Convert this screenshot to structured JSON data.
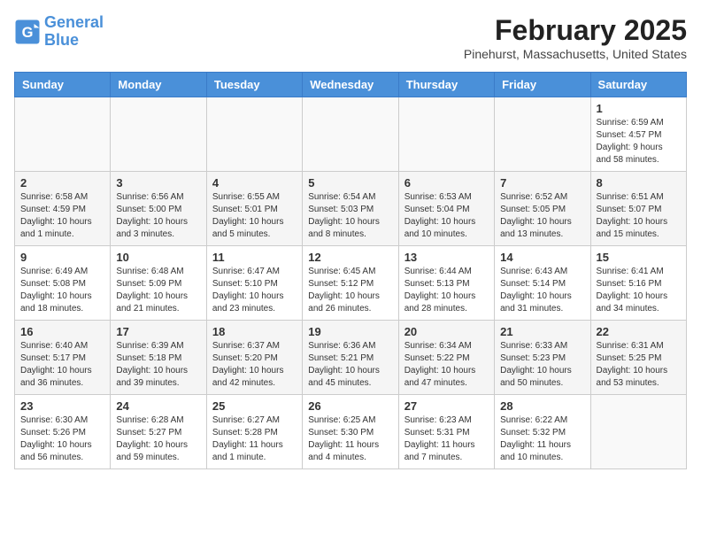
{
  "header": {
    "logo_line1": "General",
    "logo_line2": "Blue",
    "title": "February 2025",
    "subtitle": "Pinehurst, Massachusetts, United States"
  },
  "days_of_week": [
    "Sunday",
    "Monday",
    "Tuesday",
    "Wednesday",
    "Thursday",
    "Friday",
    "Saturday"
  ],
  "weeks": [
    [
      {
        "day": "",
        "info": ""
      },
      {
        "day": "",
        "info": ""
      },
      {
        "day": "",
        "info": ""
      },
      {
        "day": "",
        "info": ""
      },
      {
        "day": "",
        "info": ""
      },
      {
        "day": "",
        "info": ""
      },
      {
        "day": "1",
        "info": "Sunrise: 6:59 AM\nSunset: 4:57 PM\nDaylight: 9 hours\nand 58 minutes."
      }
    ],
    [
      {
        "day": "2",
        "info": "Sunrise: 6:58 AM\nSunset: 4:59 PM\nDaylight: 10 hours\nand 1 minute."
      },
      {
        "day": "3",
        "info": "Sunrise: 6:56 AM\nSunset: 5:00 PM\nDaylight: 10 hours\nand 3 minutes."
      },
      {
        "day": "4",
        "info": "Sunrise: 6:55 AM\nSunset: 5:01 PM\nDaylight: 10 hours\nand 5 minutes."
      },
      {
        "day": "5",
        "info": "Sunrise: 6:54 AM\nSunset: 5:03 PM\nDaylight: 10 hours\nand 8 minutes."
      },
      {
        "day": "6",
        "info": "Sunrise: 6:53 AM\nSunset: 5:04 PM\nDaylight: 10 hours\nand 10 minutes."
      },
      {
        "day": "7",
        "info": "Sunrise: 6:52 AM\nSunset: 5:05 PM\nDaylight: 10 hours\nand 13 minutes."
      },
      {
        "day": "8",
        "info": "Sunrise: 6:51 AM\nSunset: 5:07 PM\nDaylight: 10 hours\nand 15 minutes."
      }
    ],
    [
      {
        "day": "9",
        "info": "Sunrise: 6:49 AM\nSunset: 5:08 PM\nDaylight: 10 hours\nand 18 minutes."
      },
      {
        "day": "10",
        "info": "Sunrise: 6:48 AM\nSunset: 5:09 PM\nDaylight: 10 hours\nand 21 minutes."
      },
      {
        "day": "11",
        "info": "Sunrise: 6:47 AM\nSunset: 5:10 PM\nDaylight: 10 hours\nand 23 minutes."
      },
      {
        "day": "12",
        "info": "Sunrise: 6:45 AM\nSunset: 5:12 PM\nDaylight: 10 hours\nand 26 minutes."
      },
      {
        "day": "13",
        "info": "Sunrise: 6:44 AM\nSunset: 5:13 PM\nDaylight: 10 hours\nand 28 minutes."
      },
      {
        "day": "14",
        "info": "Sunrise: 6:43 AM\nSunset: 5:14 PM\nDaylight: 10 hours\nand 31 minutes."
      },
      {
        "day": "15",
        "info": "Sunrise: 6:41 AM\nSunset: 5:16 PM\nDaylight: 10 hours\nand 34 minutes."
      }
    ],
    [
      {
        "day": "16",
        "info": "Sunrise: 6:40 AM\nSunset: 5:17 PM\nDaylight: 10 hours\nand 36 minutes."
      },
      {
        "day": "17",
        "info": "Sunrise: 6:39 AM\nSunset: 5:18 PM\nDaylight: 10 hours\nand 39 minutes."
      },
      {
        "day": "18",
        "info": "Sunrise: 6:37 AM\nSunset: 5:20 PM\nDaylight: 10 hours\nand 42 minutes."
      },
      {
        "day": "19",
        "info": "Sunrise: 6:36 AM\nSunset: 5:21 PM\nDaylight: 10 hours\nand 45 minutes."
      },
      {
        "day": "20",
        "info": "Sunrise: 6:34 AM\nSunset: 5:22 PM\nDaylight: 10 hours\nand 47 minutes."
      },
      {
        "day": "21",
        "info": "Sunrise: 6:33 AM\nSunset: 5:23 PM\nDaylight: 10 hours\nand 50 minutes."
      },
      {
        "day": "22",
        "info": "Sunrise: 6:31 AM\nSunset: 5:25 PM\nDaylight: 10 hours\nand 53 minutes."
      }
    ],
    [
      {
        "day": "23",
        "info": "Sunrise: 6:30 AM\nSunset: 5:26 PM\nDaylight: 10 hours\nand 56 minutes."
      },
      {
        "day": "24",
        "info": "Sunrise: 6:28 AM\nSunset: 5:27 PM\nDaylight: 10 hours\nand 59 minutes."
      },
      {
        "day": "25",
        "info": "Sunrise: 6:27 AM\nSunset: 5:28 PM\nDaylight: 11 hours\nand 1 minute."
      },
      {
        "day": "26",
        "info": "Sunrise: 6:25 AM\nSunset: 5:30 PM\nDaylight: 11 hours\nand 4 minutes."
      },
      {
        "day": "27",
        "info": "Sunrise: 6:23 AM\nSunset: 5:31 PM\nDaylight: 11 hours\nand 7 minutes."
      },
      {
        "day": "28",
        "info": "Sunrise: 6:22 AM\nSunset: 5:32 PM\nDaylight: 11 hours\nand 10 minutes."
      },
      {
        "day": "",
        "info": ""
      }
    ]
  ]
}
